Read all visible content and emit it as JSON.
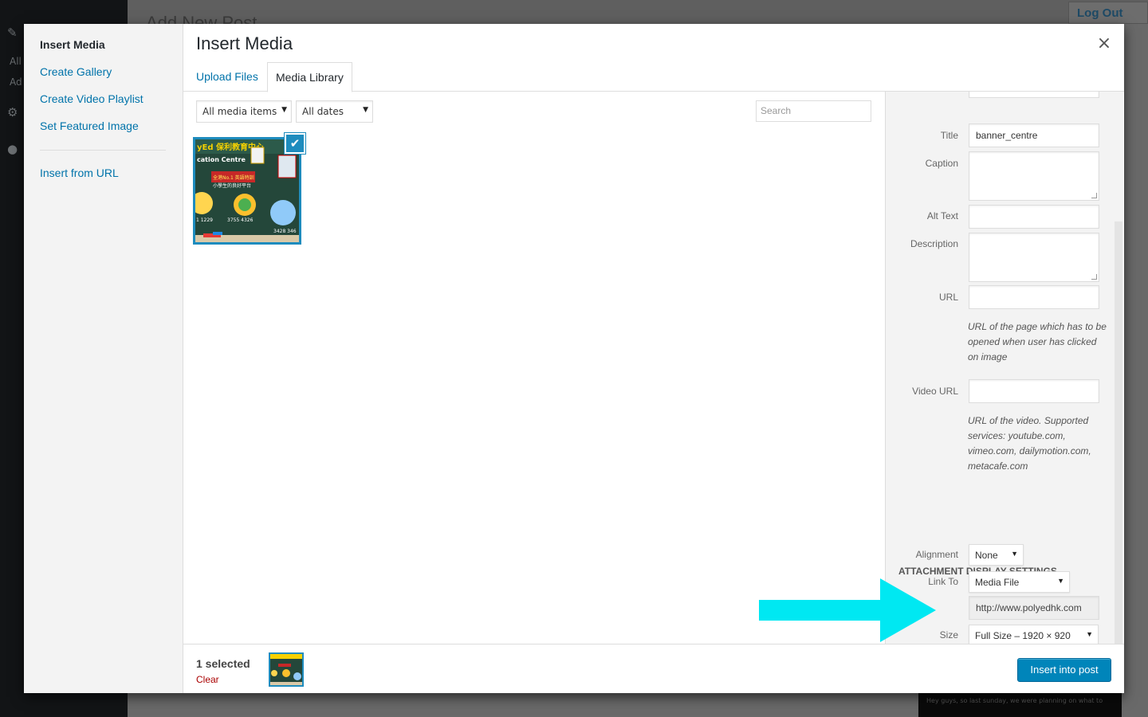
{
  "background": {
    "page_title": "Add New Post",
    "logout_label": "Log Out",
    "sidebar_texts": [
      "All",
      "Ad"
    ],
    "strip_text": "Hey guys, so last sunday, we were planning on what to"
  },
  "menu": {
    "items": [
      {
        "label": "Insert Media"
      },
      {
        "label": "Create Gallery"
      },
      {
        "label": "Create Video Playlist"
      },
      {
        "label": "Set Featured Image"
      },
      {
        "label": "Insert from URL"
      }
    ]
  },
  "frame": {
    "title": "Insert Media",
    "close_symbol": "×"
  },
  "tabs": [
    {
      "label": "Upload Files"
    },
    {
      "label": "Media Library"
    }
  ],
  "filters": {
    "media_type": "All media items",
    "dates": "All dates",
    "search_placeholder": "Search"
  },
  "attachment": {
    "check_symbol": "✔",
    "thumb_texts": [
      "yEd 保利教育中心",
      "cation Centre",
      "全港No.1 英語特訓",
      "小學生的良好平台",
      "1 1229",
      "3755 4326",
      "3428 346"
    ]
  },
  "details": {
    "title_label": "Title",
    "title_value": "banner_centre",
    "caption_label": "Caption",
    "alt_label": "Alt Text",
    "description_label": "Description",
    "url_label": "URL",
    "url_help": "URL of the page which has to be opened when user has clicked on image",
    "video_url_label": "Video URL",
    "video_help": "URL of the video. Supported services: youtube.com, vimeo.com, dailymotion.com, metacafe.com",
    "display_heading": "Attachment Display Settings",
    "alignment_label": "Alignment",
    "alignment_value": "None",
    "link_label": "Link To",
    "link_value": "Media File",
    "link_url": "http://www.polyedhk.com",
    "size_label": "Size",
    "size_value": "Full Size – 1920 × 920"
  },
  "bottombar": {
    "selected": "1 selected",
    "clear": "Clear",
    "insert_button": "Insert into post"
  },
  "colors": {
    "accent": "#0073aa",
    "selection": "#1e8cbe",
    "primary_button": "#0085ba",
    "annotation_arrow": "#00e5f0",
    "clear_link": "#a00000"
  }
}
